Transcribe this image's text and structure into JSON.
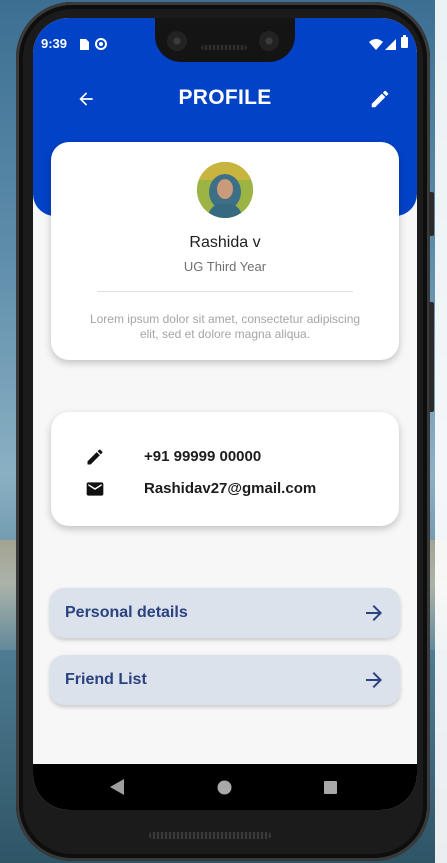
{
  "status_bar": {
    "time": "9:39",
    "left_icons": [
      "sim-card-icon",
      "at-sign-icon"
    ],
    "right_icons": [
      "wifi-icon",
      "signal-icon",
      "battery-icon"
    ]
  },
  "header": {
    "title": "PROFILE",
    "back_icon": "arrow-left-icon",
    "edit_icon": "pencil-icon",
    "color": "#0242c7"
  },
  "profile": {
    "name": "Rashida v",
    "subtitle": "UG Third Year",
    "bio": "Lorem ipsum dolor sit amet, consectetur adipiscing elit, sed et dolore magna aliqua."
  },
  "contact": {
    "phone": "+91 99999 00000",
    "phone_icon": "pencil-icon",
    "email": "Rashidav27@gmail.com",
    "email_icon": "mail-icon"
  },
  "menu": {
    "items": [
      {
        "label": "Personal details",
        "icon": "arrow-right-icon"
      },
      {
        "label": "Friend List",
        "icon": "arrow-right-icon"
      }
    ],
    "accent": "#2a4280"
  },
  "nav": {
    "buttons": [
      "back-triangle-icon",
      "home-circle-icon",
      "recents-square-icon"
    ]
  }
}
